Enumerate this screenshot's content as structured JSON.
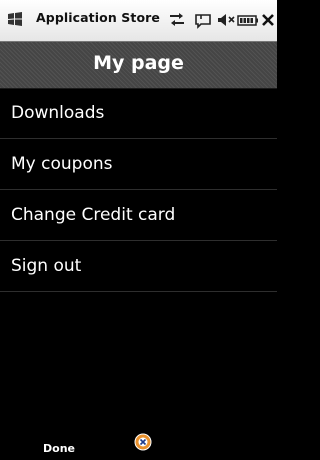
{
  "status_bar": {
    "windows_logo_icon": "windows-flag-icon",
    "app_title": "Application Store",
    "icons": [
      "connectivity-arrows-icon",
      "message-icon",
      "speaker-muted-icon",
      "battery-icon",
      "close-icon"
    ]
  },
  "header": {
    "title": "My page"
  },
  "menu": {
    "items": [
      {
        "label": "Downloads"
      },
      {
        "label": "My coupons"
      },
      {
        "label": "Change Credit card"
      },
      {
        "label": "Sign out"
      }
    ]
  },
  "softkeys": {
    "left_label": "Done",
    "center_icon": "input-panel-icon"
  },
  "colors": {
    "status_bar_bg": "#ffffff",
    "title_bar_bg": "#454545",
    "background": "#000000",
    "text": "#ffffff"
  }
}
